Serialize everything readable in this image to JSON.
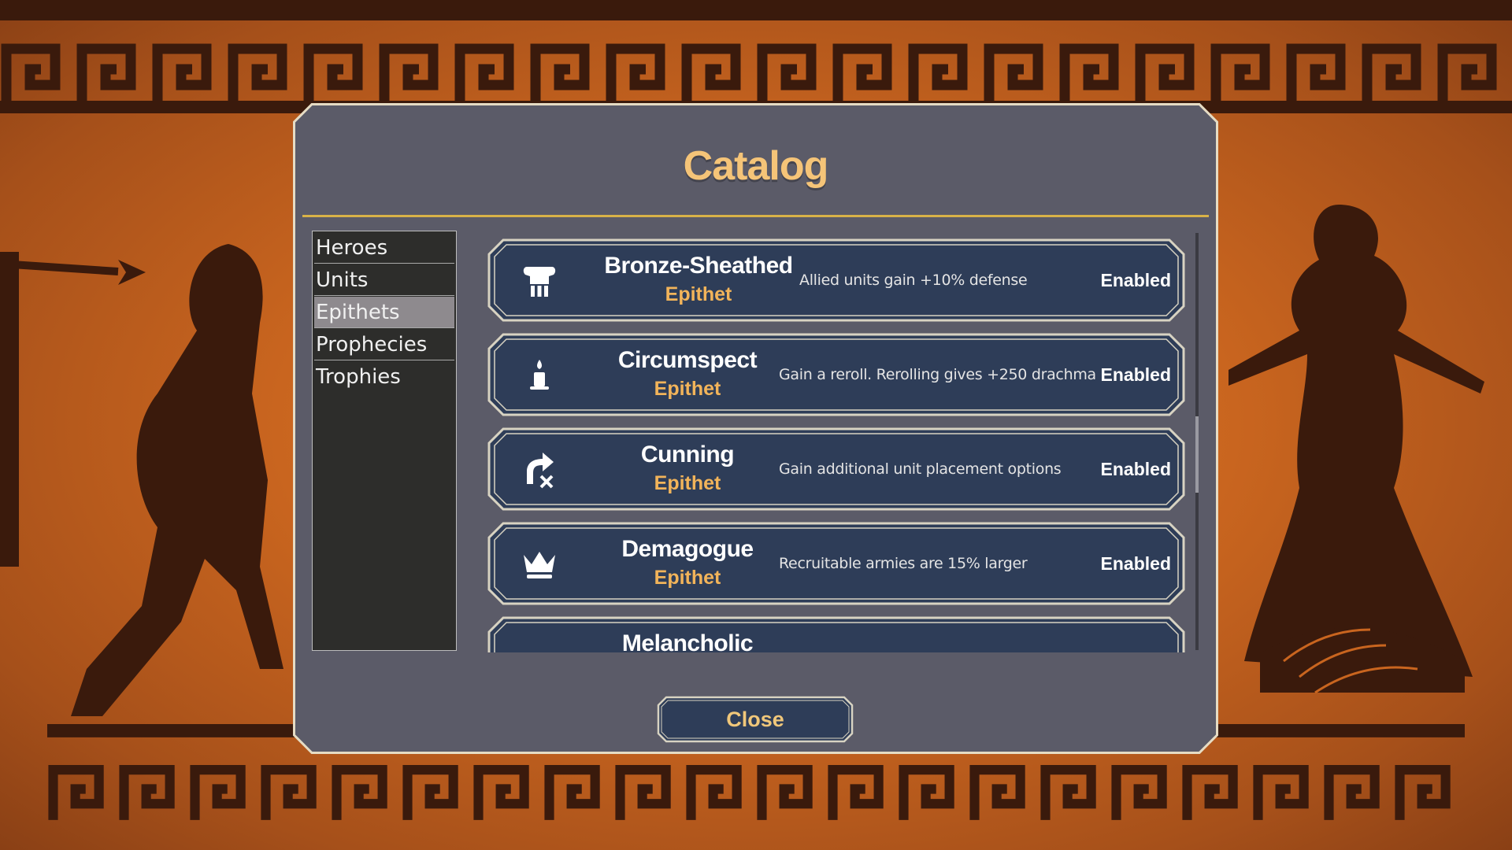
{
  "dialog": {
    "title": "Catalog",
    "close_label": "Close"
  },
  "sidebar": {
    "items": [
      {
        "label": "Heroes",
        "active": false
      },
      {
        "label": "Units",
        "active": false
      },
      {
        "label": "Epithets",
        "active": true
      },
      {
        "label": "Prophecies",
        "active": false
      },
      {
        "label": "Trophies",
        "active": false
      }
    ]
  },
  "entries": [
    {
      "name": "Bronze-Sheathed",
      "type": "Epithet",
      "description": "Allied units gain +10% defense",
      "status": "Enabled",
      "icon": "armor-icon"
    },
    {
      "name": "Circumspect",
      "type": "Epithet",
      "description": "Gain a reroll. Rerolling gives +250 drachma",
      "status": "Enabled",
      "icon": "candle-icon"
    },
    {
      "name": "Cunning",
      "type": "Epithet",
      "description": "Gain additional unit placement options",
      "status": "Enabled",
      "icon": "turn-arrow-icon"
    },
    {
      "name": "Demagogue",
      "type": "Epithet",
      "description": "Recruitable armies are 15% larger",
      "status": "Enabled",
      "icon": "crown-icon"
    },
    {
      "name": "Melancholic",
      "type": "",
      "description": "",
      "status": "",
      "icon": "arrows-icon"
    }
  ],
  "colors": {
    "dialog_bg": "#5b5b68",
    "accent_gold": "#d8b248",
    "title": "#f5c478",
    "card_bg": "#2e3d58",
    "epithet_text": "#f2b45a",
    "background_orange": "#c9651f",
    "silhouette": "#3a1a0c"
  }
}
